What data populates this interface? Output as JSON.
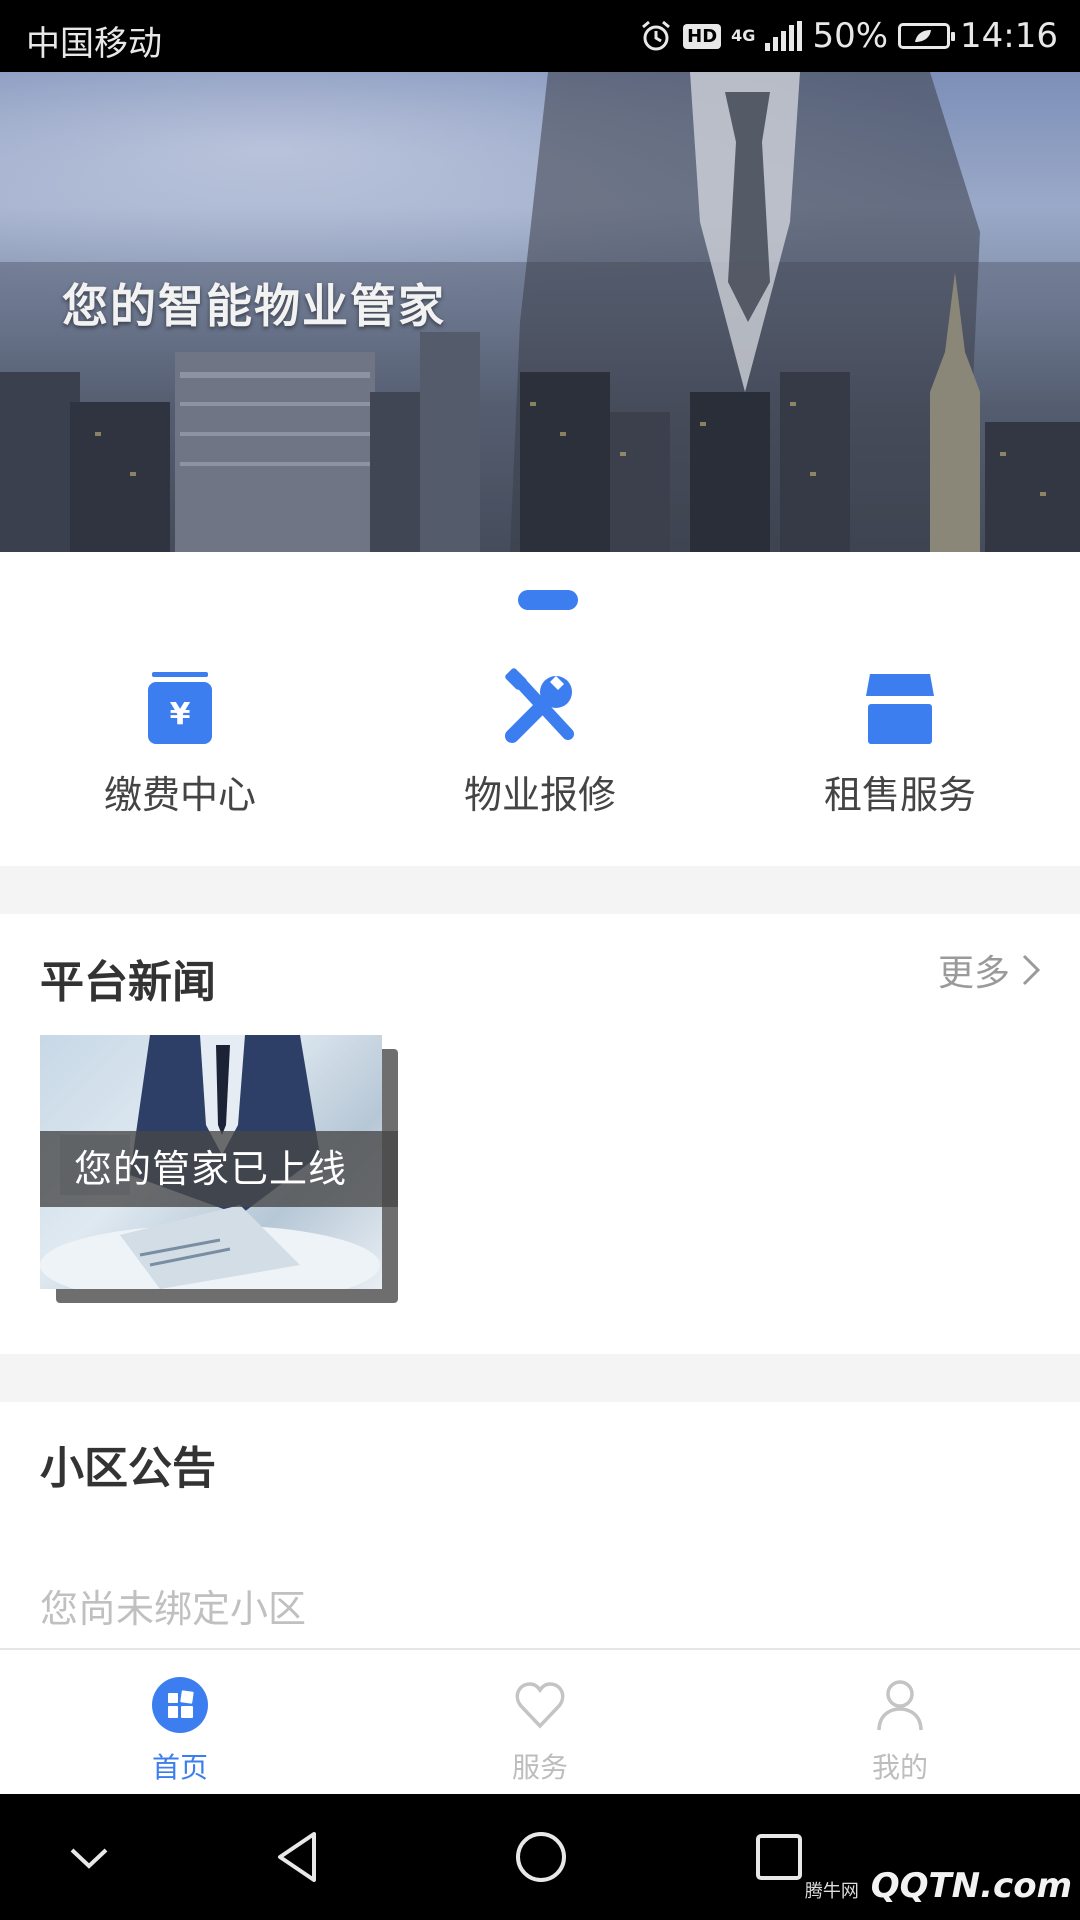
{
  "status_bar": {
    "carrier": "中国移动",
    "hd": "HD",
    "network": "4G",
    "battery": "50%",
    "time": "14:16"
  },
  "banner": {
    "title": "您的智能物业管家"
  },
  "quick_entries": [
    {
      "label": "缴费中心",
      "icon": "payment-icon"
    },
    {
      "label": "物业报修",
      "icon": "repair-tools-icon"
    },
    {
      "label": "租售服务",
      "icon": "storefront-icon"
    }
  ],
  "news": {
    "title": "平台新闻",
    "more": "更多",
    "items": [
      {
        "caption": "您的管家已上线"
      }
    ]
  },
  "notice": {
    "title": "小区公告",
    "empty": "您尚未绑定小区"
  },
  "tab_bar": {
    "active": "首页",
    "items": [
      {
        "label": "首页",
        "icon": "home-grid-icon"
      },
      {
        "label": "服务",
        "icon": "heart-icon"
      },
      {
        "label": "我的",
        "icon": "person-icon"
      }
    ]
  },
  "watermark": {
    "text": "QQTN.com",
    "sub": "腾牛网"
  },
  "colors": {
    "accent": "#3c7df0",
    "text": "#333333",
    "muted": "#c0c0c0"
  }
}
